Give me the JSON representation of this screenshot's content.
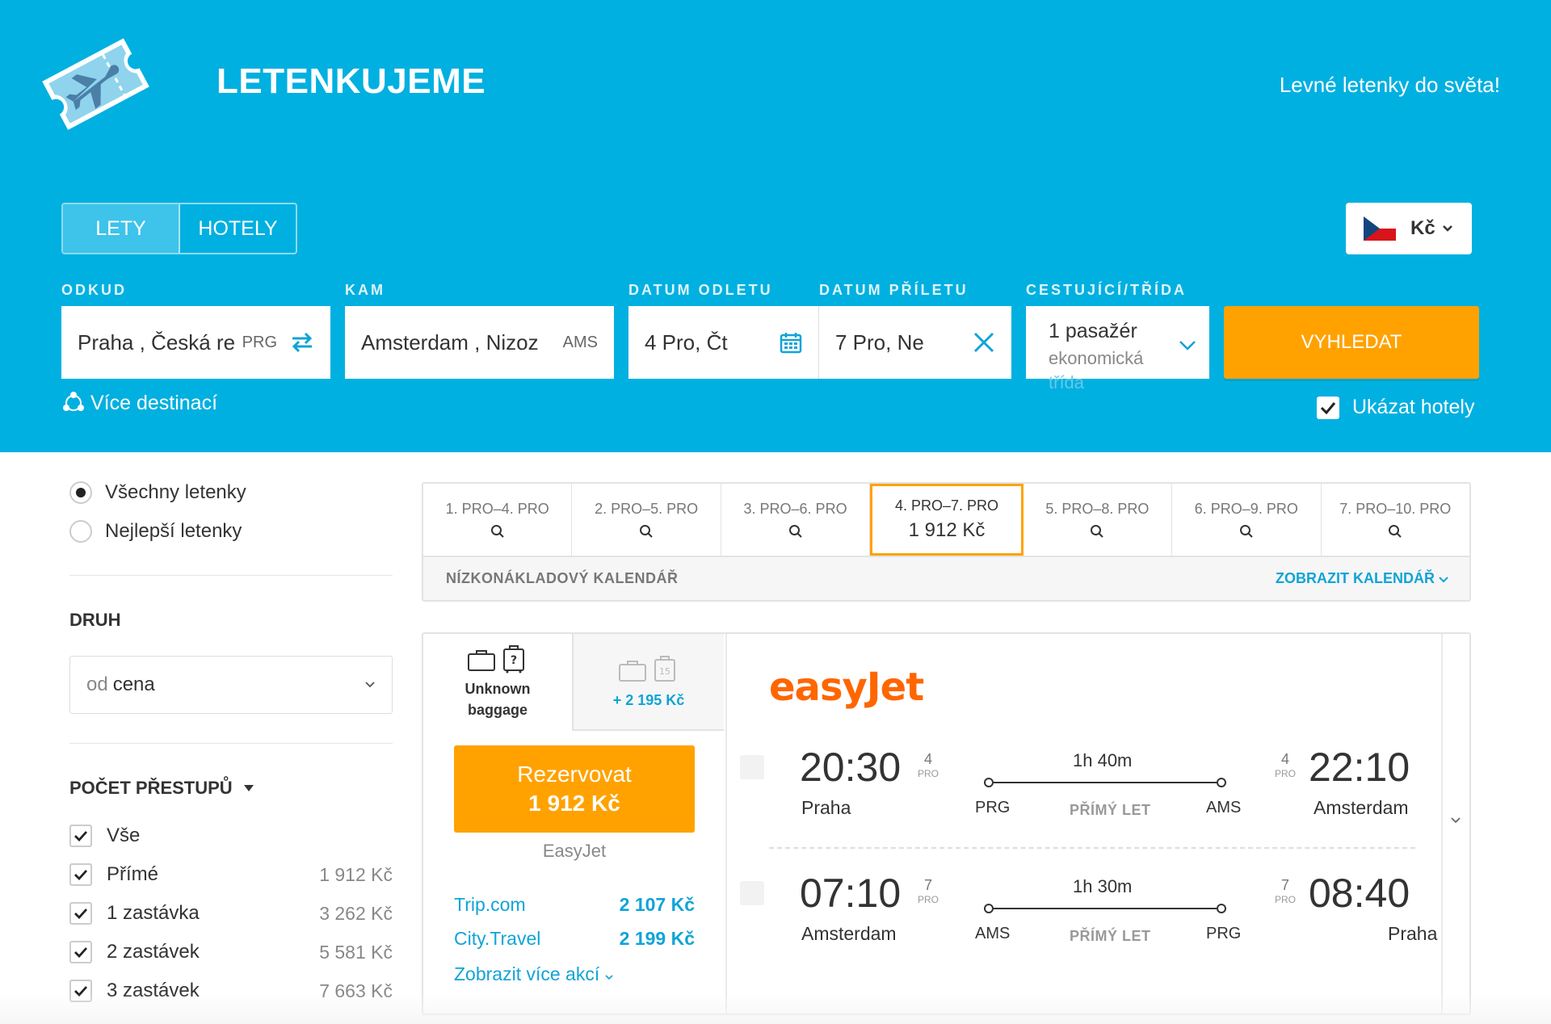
{
  "header": {
    "brand": "LETENKUJEME",
    "tagline": "Levné letenky do světa!",
    "logo_icon": "airplane-ticket-icon",
    "background": "#00b0e0"
  },
  "tabs": [
    {
      "label": "LETY",
      "active": true
    },
    {
      "label": "HOTELY",
      "active": false
    }
  ],
  "currency": {
    "label": "Kč",
    "flag_icon": "czech-flag-icon"
  },
  "search": {
    "from": {
      "label": "ODKUD",
      "value": "Praha , Česká re",
      "code": "PRG"
    },
    "to": {
      "label": "KAM",
      "value": "Amsterdam , Nizoz",
      "code": "AMS"
    },
    "depart": {
      "label": "DATUM ODLETU",
      "value": "4 Pro, Čt"
    },
    "return": {
      "label": "DATUM PŘÍLETU",
      "value": "7 Pro, Ne"
    },
    "passengers": {
      "label": "CESTUJÍCÍ/TŘÍDA",
      "value": "1 pasažér",
      "class": "ekonomická",
      "class_overflow": "třída"
    },
    "button": "VYHLEDAT",
    "more_destinations": "Více destinací",
    "show_hotels": "Ukázat hotely",
    "show_hotels_checked": true
  },
  "sidebar": {
    "radios": [
      {
        "label": "Všechny letenky",
        "selected": true
      },
      {
        "label": "Nejlepší letenky",
        "selected": false
      }
    ],
    "sort_title": "DRUH",
    "sort_prefix": "od",
    "sort_value": "cena",
    "stops_title": "POČET PŘESTUPŮ",
    "stops": [
      {
        "label": "Vše",
        "price": ""
      },
      {
        "label": "Přímé",
        "price": "1 912 Kč"
      },
      {
        "label": "1 zastávka",
        "price": "3 262 Kč"
      },
      {
        "label": "2 zastávek",
        "price": "5 581 Kč"
      },
      {
        "label": "3 zastávek",
        "price": "7 663 Kč"
      }
    ]
  },
  "date_strip": {
    "dates": [
      {
        "label": "1. PRO–4. PRO",
        "price": ""
      },
      {
        "label": "2. PRO–5. PRO",
        "price": ""
      },
      {
        "label": "3. PRO–6. PRO",
        "price": ""
      },
      {
        "label": "4. PRO–7. PRO",
        "price": "1 912 Kč",
        "active": true
      },
      {
        "label": "5. PRO–8. PRO",
        "price": ""
      },
      {
        "label": "6. PRO–9. PRO",
        "price": ""
      },
      {
        "label": "7. PRO–10. PRO",
        "price": ""
      }
    ],
    "calendar_title": "NÍZKONÁKLADOVÝ KALENDÁŘ",
    "calendar_link": "ZOBRAZIT KALENDÁŘ"
  },
  "result": {
    "baggage_unknown": "Unknown baggage",
    "baggage_unknown_l1": "Unknown",
    "baggage_unknown_l2": "baggage",
    "baggage_extra": "+ 2 195 Kč",
    "book_label": "Rezervovat",
    "book_price": "1 912 Kč",
    "seller": "EasyJet",
    "offers": [
      {
        "name": "Trip.com",
        "price": "2 107 Kč"
      },
      {
        "name": "City.Travel",
        "price": "2 199 Kč"
      }
    ],
    "more_deals": "Zobrazit více akcí",
    "airline": "easyJet",
    "airline_color": "#ff6600",
    "segments": [
      {
        "dep_time": "20:30",
        "dep_day": "4",
        "dep_month": "PRO",
        "dep_city": "Praha",
        "dep_code": "PRG",
        "duration": "1h 40m",
        "type": "PŘÍMÝ LET",
        "arr_time": "22:10",
        "arr_day": "4",
        "arr_month": "PRO",
        "arr_city": "Amsterdam",
        "arr_code": "AMS"
      },
      {
        "dep_time": "07:10",
        "dep_day": "7",
        "dep_month": "PRO",
        "dep_city": "Amsterdam",
        "dep_code": "AMS",
        "duration": "1h 30m",
        "type": "PŘÍMÝ LET",
        "arr_time": "08:40",
        "arr_day": "7",
        "arr_month": "PRO",
        "arr_city": "Praha",
        "arr_code": "PRG"
      }
    ]
  },
  "colors": {
    "accent": "#ffa200",
    "link": "#10a4d6"
  }
}
